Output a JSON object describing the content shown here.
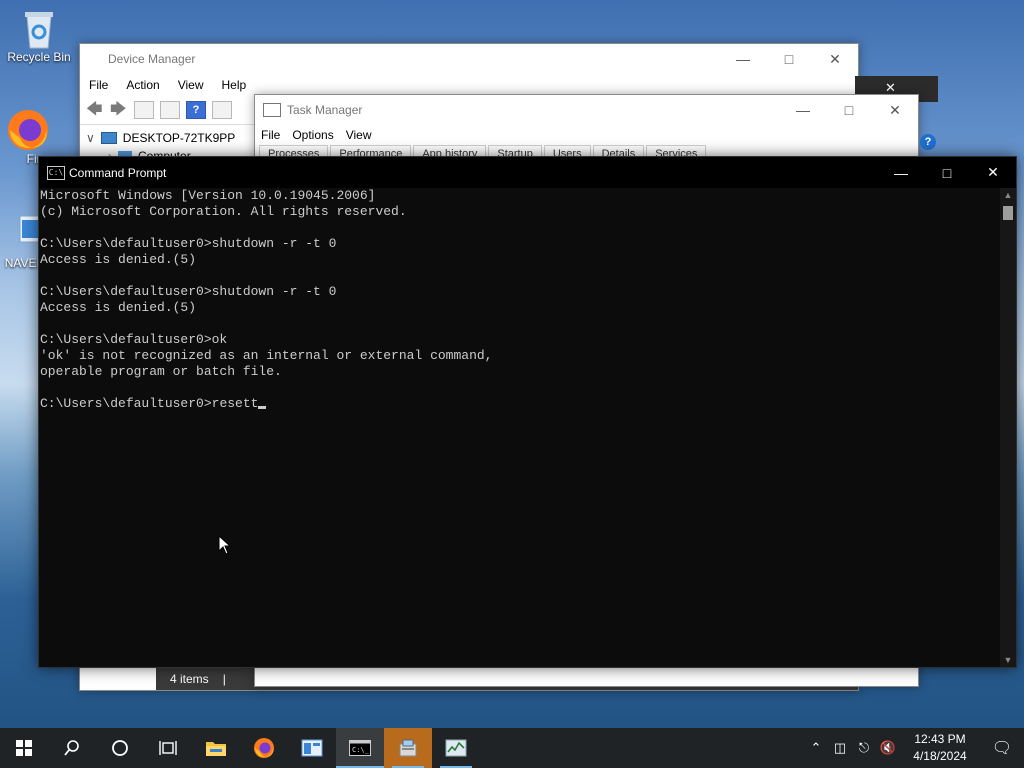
{
  "desktop": {
    "icons": [
      {
        "label": "Recycle Bin"
      },
      {
        "label": "Fire"
      },
      {
        "label": "NAVER"
      }
    ]
  },
  "device_manager": {
    "title": "Device Manager",
    "menu": [
      "File",
      "Action",
      "View",
      "Help"
    ],
    "tree": {
      "root": "DESKTOP-72TK9PP",
      "child": "Computer"
    },
    "status": "4 items"
  },
  "task_manager": {
    "title": "Task Manager",
    "menu": [
      "File",
      "Options",
      "View"
    ],
    "tabs": [
      "Processes",
      "Performance",
      "App history",
      "Startup",
      "Users",
      "Details",
      "Services"
    ]
  },
  "cmd": {
    "title": "Command Prompt",
    "lines": [
      "Microsoft Windows [Version 10.0.19045.2006]",
      "(c) Microsoft Corporation. All rights reserved.",
      "",
      "C:\\Users\\defaultuser0>shutdown -r -t 0",
      "Access is denied.(5)",
      "",
      "C:\\Users\\defaultuser0>shutdown -r -t 0",
      "Access is denied.(5)",
      "",
      "C:\\Users\\defaultuser0>ok",
      "'ok' is not recognized as an internal or external command,",
      "operable program or batch file.",
      ""
    ],
    "prompt": "C:\\Users\\defaultuser0>",
    "input": "resett"
  },
  "taskbar": {
    "clock_time": "12:43 PM",
    "clock_date": "4/18/2024",
    "icons": [
      "start-icon",
      "search-icon",
      "cortana-icon",
      "task-view-icon",
      "file-explorer-icon",
      "firefox-icon",
      "app-icon",
      "cmd-icon",
      "installer-icon",
      "task-manager-icon"
    ]
  }
}
